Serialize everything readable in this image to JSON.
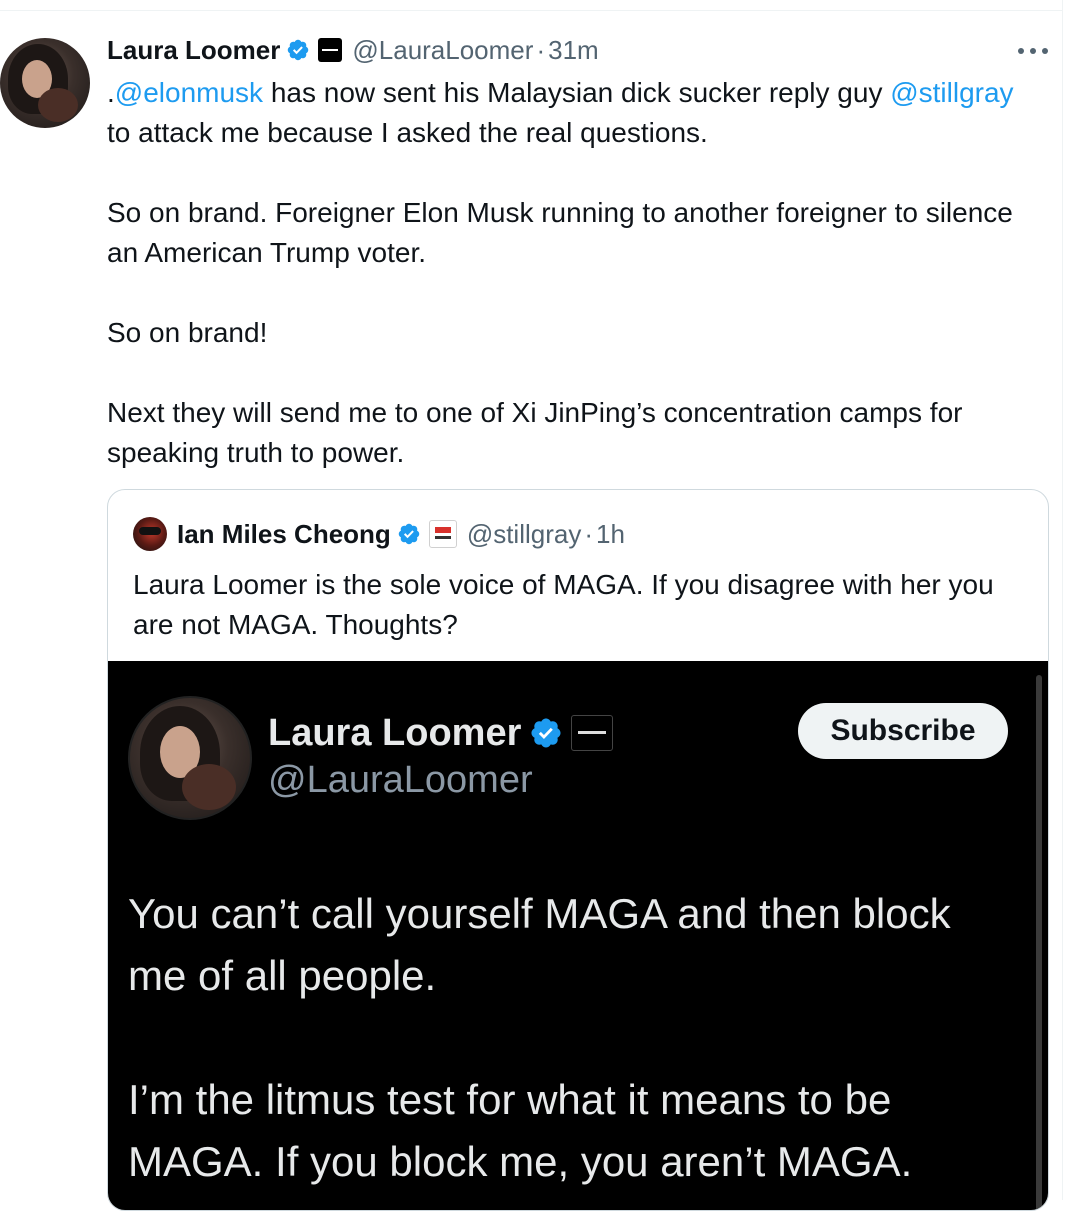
{
  "tweet": {
    "author_name": "Laura Loomer",
    "author_handle": "@LauraLoomer",
    "separator": "·",
    "time": "31m",
    "text": {
      "p1_prefix": ".",
      "p1_mention1": "@elonmusk",
      "p1_mid": " has now sent his Malaysian dick sucker reply guy ",
      "p1_mention2": "@stillgray",
      "p1_suffix": " to attack me because I asked the real questions.",
      "p2": "So on brand. Foreigner Elon Musk running to another foreigner to silence an American Trump voter.",
      "p3": "So on brand!",
      "p4": "Next they will send me to one of Xi JinPing’s concentration camps for speaking truth to power."
    }
  },
  "quote": {
    "author_name": "Ian Miles Cheong",
    "author_handle": "@stillgray",
    "separator": "·",
    "time": "1h",
    "text": "Laura Loomer is the sole voice of MAGA. If you disagree with her you are not MAGA. Thoughts?",
    "media": {
      "name": "Laura Loomer",
      "handle": "@LauraLoomer",
      "subscribe_label": "Subscribe",
      "p1": "You can’t call yourself MAGA and then block me of all people.",
      "p2": "I’m the litmus test for what it means to be MAGA. If you block me, you aren’t MAGA."
    }
  },
  "colors": {
    "link": "#1d9bf0",
    "verified": "#1d9bf0",
    "secondary_text": "#536471",
    "media_background": "#000000"
  },
  "icons": {
    "verified": "verified-badge-icon",
    "more": "more-horizontal-icon"
  }
}
